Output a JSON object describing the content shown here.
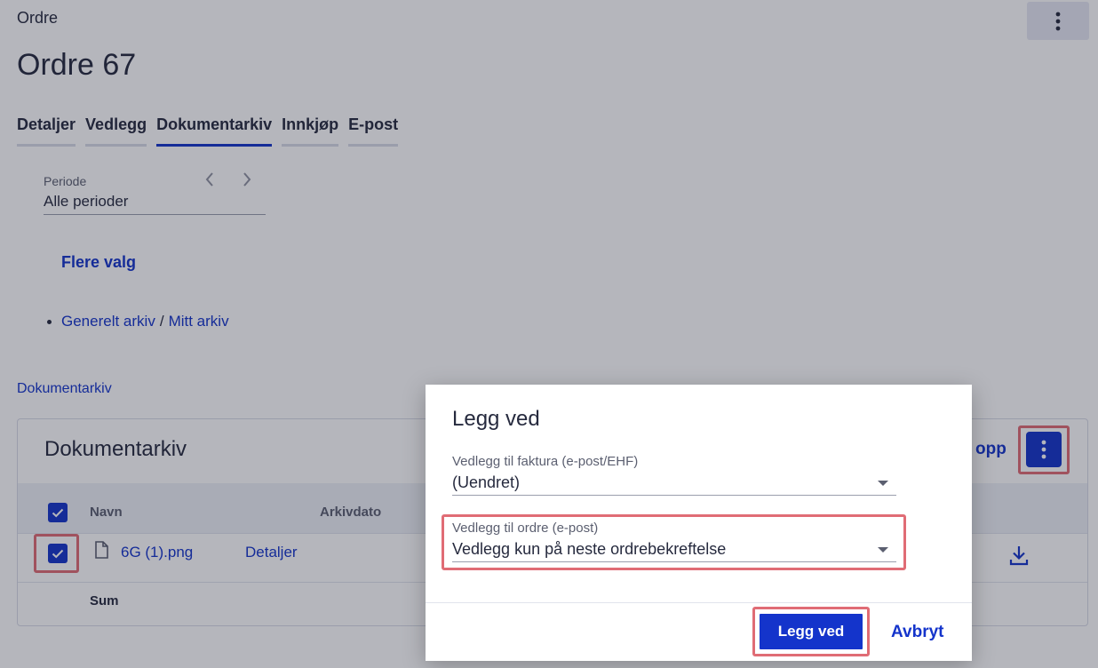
{
  "header": {
    "breadcrumb": "Ordre",
    "title": "Ordre 67"
  },
  "tabs": [
    {
      "label": "Detaljer",
      "active": false
    },
    {
      "label": "Vedlegg",
      "active": false
    },
    {
      "label": "Dokumentarkiv",
      "active": true
    },
    {
      "label": "Innkjøp",
      "active": false
    },
    {
      "label": "E-post",
      "active": false
    }
  ],
  "period": {
    "label": "Periode",
    "value": "Alle perioder"
  },
  "more_options": "Flere valg",
  "archives": {
    "general": "Generelt arkiv",
    "separator": "/",
    "mine": "Mitt arkiv"
  },
  "section_link": "Dokumentarkiv",
  "card": {
    "title": "Dokumentarkiv",
    "upload_partial": "opp",
    "columns": {
      "name": "Navn",
      "date": "Arkivdato"
    },
    "rows": [
      {
        "file_name": "6G (1).png",
        "details": "Detaljer",
        "checked": true
      }
    ],
    "sum_label": "Sum"
  },
  "dialog": {
    "title": "Legg ved",
    "invoice_field": {
      "label": "Vedlegg til faktura (e-post/EHF)",
      "value": "(Uendret)"
    },
    "order_field": {
      "label": "Vedlegg til ordre (e-post)",
      "value": "Vedlegg kun på neste ordrebekreftelse"
    },
    "confirm_label": "Legg ved",
    "cancel_label": "Avbryt"
  },
  "colors": {
    "accent": "#1434cb",
    "highlight": "#e06c75"
  }
}
